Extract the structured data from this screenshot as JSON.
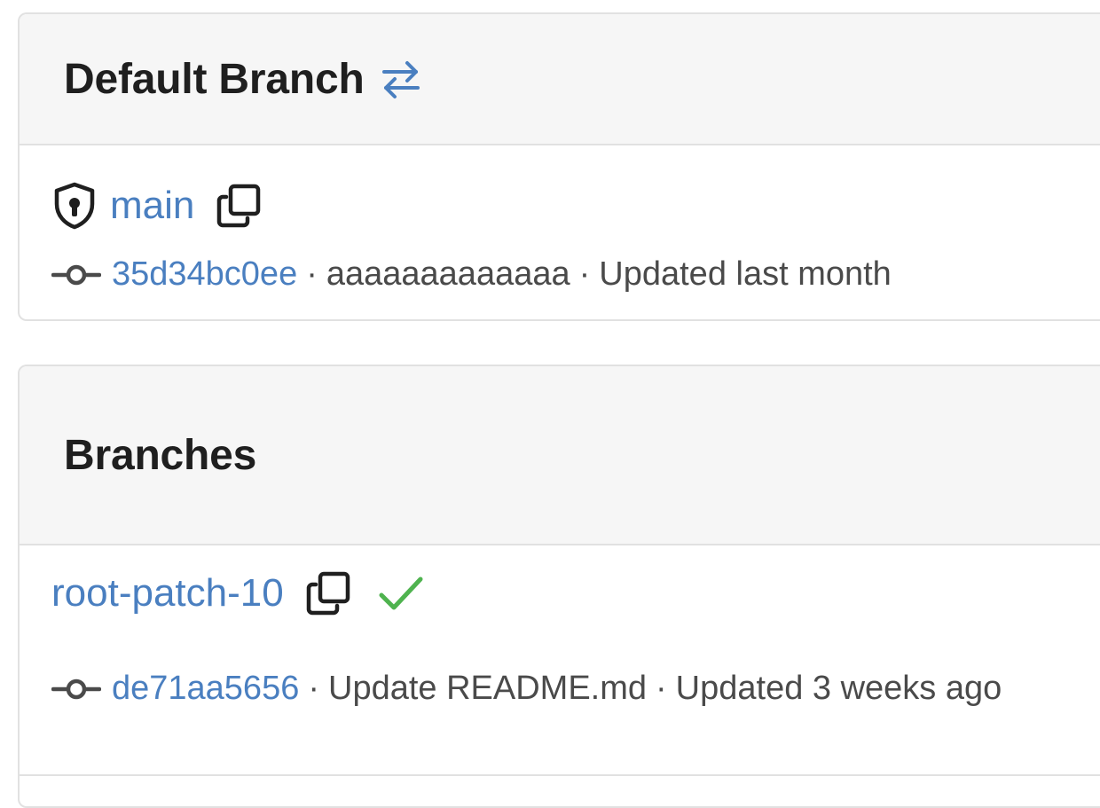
{
  "default_section": {
    "title": "Default Branch",
    "swap_icon": "arrows-swap-icon",
    "branch": {
      "name": "main",
      "protected_icon": "shield-lock-icon",
      "copy_icon": "copy-icon",
      "commit_icon": "commit-icon",
      "commit_sha": "35d34bc0ee",
      "separator": "·",
      "commit_message": "aaaaaaaaaaaaa",
      "updated": "Updated last month"
    }
  },
  "branches_section": {
    "title": "Branches",
    "items": [
      {
        "name": "root-patch-10",
        "copy_icon": "copy-icon",
        "status_icon": "check-icon",
        "commit_icon": "commit-icon",
        "commit_sha": "de71aa5656",
        "separator": "·",
        "commit_message": "Update README.md",
        "updated": "Updated 3 weeks ago"
      }
    ]
  },
  "colors": {
    "link": "#4a7fc0",
    "check": "#4fb34f",
    "header_bg": "#f6f6f6",
    "border": "#e1e1e1"
  }
}
